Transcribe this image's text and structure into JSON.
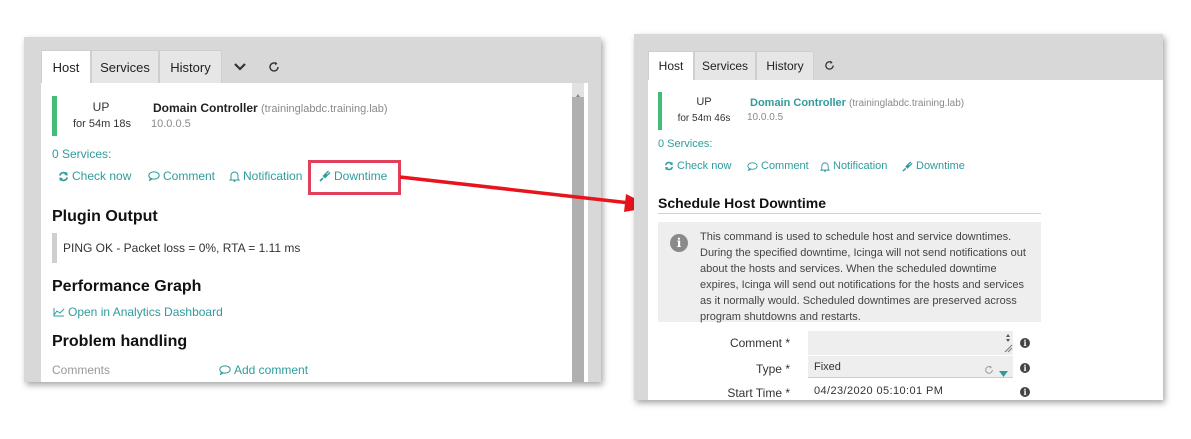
{
  "left": {
    "tabs": [
      "Host",
      "Services",
      "History"
    ],
    "host": {
      "state": "UP",
      "duration": "for 54m 18s",
      "name": "Domain Controller",
      "fqdn": "(traininglabdc.training.lab)",
      "ip": "10.0.0.5"
    },
    "services_link": "0 Services:",
    "actions": {
      "check_now": "Check now",
      "comment": "Comment",
      "notification": "Notification",
      "downtime": "Downtime"
    },
    "plugin_output_heading": "Plugin Output",
    "plugin_output": "PING OK - Packet loss = 0%, RTA = 1.11 ms",
    "performance_graph_heading": "Performance Graph",
    "analytics_link": "Open in Analytics Dashboard",
    "problem_handling_heading": "Problem handling",
    "comments_label": "Comments",
    "add_comment": "Add comment"
  },
  "right": {
    "tabs": [
      "Host",
      "Services",
      "History"
    ],
    "host": {
      "state": "UP",
      "duration": "for 54m 46s",
      "name": "Domain Controller",
      "fqdn": "(traininglabdc.training.lab)",
      "ip": "10.0.0.5"
    },
    "services_link": "0 Services:",
    "actions": {
      "check_now": "Check now",
      "comment": "Comment",
      "notification": "Notification",
      "downtime": "Downtime"
    },
    "schedule_heading": "Schedule Host Downtime",
    "info_text": "This command is used to schedule host and service downtimes. During the specified downtime, Icinga will not send notifications out about the hosts and services. When the scheduled downtime expires, Icinga will send out notifications for the hosts and services as it normally would. Scheduled downtimes are preserved across program shutdowns and restarts.",
    "form": {
      "comment_label": "Comment *",
      "comment_value": "",
      "type_label": "Type *",
      "type_value": "Fixed",
      "start_label": "Start Time *",
      "start_value": "04/23/2020 05:10:01 PM"
    }
  },
  "colors": {
    "accent": "#2f9c9c",
    "up_green": "#44bb77",
    "highlight": "#e0405a",
    "arrow": "#e8141c"
  }
}
